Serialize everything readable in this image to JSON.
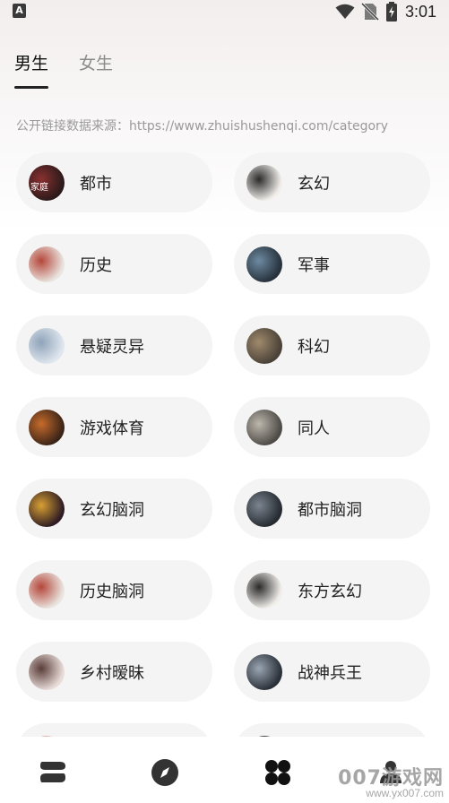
{
  "status_bar": {
    "time": "3:01",
    "left_icon": "A"
  },
  "tabs": [
    {
      "label": "男生",
      "active": true
    },
    {
      "label": "女生",
      "active": false
    }
  ],
  "source_note": "公开链接数据来源：https://www.zhuishushenqi.com/category",
  "categories": [
    {
      "label": "都市",
      "thumb_color": "#2b1a1a",
      "thumb_accent": "#8a3030",
      "thumb_text": "家庭"
    },
    {
      "label": "玄幻",
      "thumb_color": "#f1eeea",
      "thumb_accent": "#2a2a2a",
      "thumb_text": ""
    },
    {
      "label": "历史",
      "thumb_color": "#e9e4df",
      "thumb_accent": "#b5473a",
      "thumb_text": ""
    },
    {
      "label": "军事",
      "thumb_color": "#27323c",
      "thumb_accent": "#6d8aa1",
      "thumb_text": ""
    },
    {
      "label": "悬疑灵异",
      "thumb_color": "#dfe6ee",
      "thumb_accent": "#8fa3b9",
      "thumb_text": ""
    },
    {
      "label": "科幻",
      "thumb_color": "#4a4238",
      "thumb_accent": "#a08a6c",
      "thumb_text": ""
    },
    {
      "label": "游戏体育",
      "thumb_color": "#3b2418",
      "thumb_accent": "#c66b2b",
      "thumb_text": ""
    },
    {
      "label": "同人",
      "thumb_color": "#4e4b47",
      "thumb_accent": "#bdb7ac",
      "thumb_text": ""
    },
    {
      "label": "玄幻脑洞",
      "thumb_color": "#2e1c23",
      "thumb_accent": "#d8a033",
      "thumb_text": ""
    },
    {
      "label": "都市脑洞",
      "thumb_color": "#262b31",
      "thumb_accent": "#7b8590",
      "thumb_text": ""
    },
    {
      "label": "历史脑洞",
      "thumb_color": "#e9e4df",
      "thumb_accent": "#b5473a",
      "thumb_text": ""
    },
    {
      "label": "东方玄幻",
      "thumb_color": "#f1eeea",
      "thumb_accent": "#2a2a2a",
      "thumb_text": ""
    },
    {
      "label": "乡村暧昧",
      "thumb_color": "#e8dcd8",
      "thumb_accent": "#5a3d3a",
      "thumb_text": ""
    },
    {
      "label": "战神兵王",
      "thumb_color": "#2a3038",
      "thumb_accent": "#9aa6b3",
      "thumb_text": ""
    },
    {
      "label": "",
      "thumb_color": "#efe9e6",
      "thumb_accent": "#b5473a",
      "thumb_text": ""
    },
    {
      "label": "",
      "thumb_color": "#2b2b2b",
      "thumb_accent": "#777777",
      "thumb_text": ""
    }
  ],
  "bottom_nav": [
    {
      "icon": "bookshelf-icon"
    },
    {
      "icon": "compass-icon"
    },
    {
      "icon": "category-grid-icon"
    },
    {
      "icon": "profile-icon"
    }
  ],
  "watermark": {
    "line1": "007游戏网",
    "line2": "www.yx007.com"
  },
  "colors": {
    "text_primary": "#222222",
    "text_secondary": "#8a8a8a",
    "card_bg": "#f4f4f4",
    "nav_icon": "#333333"
  }
}
